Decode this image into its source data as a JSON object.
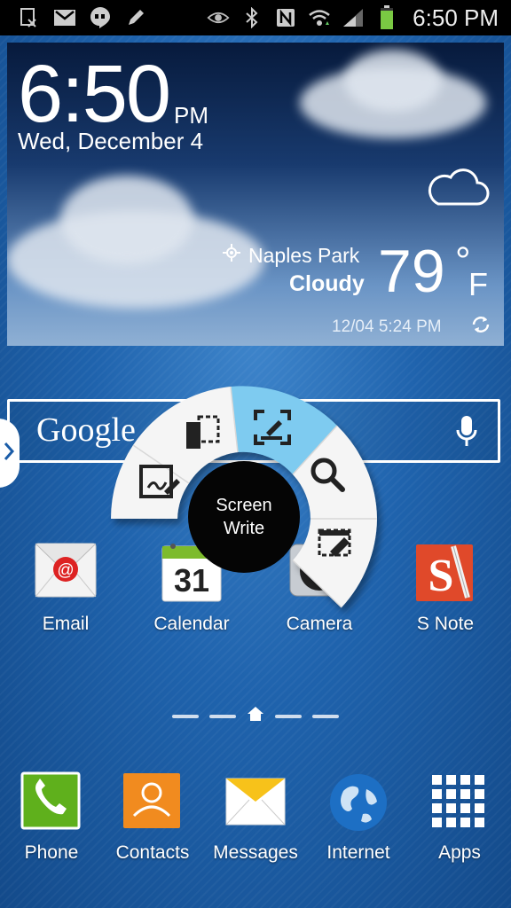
{
  "status_bar": {
    "left_icons": [
      "screenshot-icon",
      "gmail-icon",
      "hangouts-icon",
      "pen-icon"
    ],
    "right_icons": [
      "smart-stay-eye-icon",
      "bluetooth-icon",
      "nfc-icon",
      "wifi-icon",
      "signal-icon",
      "battery-icon"
    ],
    "time": "6:50 PM",
    "battery_level": 0.85
  },
  "weather_widget": {
    "time": "6:50",
    "ampm": "PM",
    "date": "Wed, December 4",
    "location": "Naples Park",
    "condition": "Cloudy",
    "temperature": "79",
    "degree_symbol": "°",
    "unit": "F",
    "updated": "12/04 5:24 PM",
    "weather_icon": "cloud-icon",
    "refresh_icon": "refresh-icon"
  },
  "search_bar": {
    "logo": "Google",
    "mic_icon": "microphone-icon"
  },
  "air_command": {
    "center_label_line1": "Screen",
    "center_label_line2": "Write",
    "items": [
      "action-memo-icon",
      "scrap-booker-icon",
      "screen-write-icon",
      "s-finder-icon",
      "pen-window-icon"
    ],
    "highlight_color": "#7ecbf0"
  },
  "apps_row": [
    {
      "label": "Email"
    },
    {
      "label": "Calendar",
      "day": "31"
    },
    {
      "label": "Camera"
    },
    {
      "label": "S Note"
    }
  ],
  "dock": [
    {
      "label": "Phone"
    },
    {
      "label": "Contacts"
    },
    {
      "label": "Messages"
    },
    {
      "label": "Internet"
    },
    {
      "label": "Apps"
    }
  ]
}
